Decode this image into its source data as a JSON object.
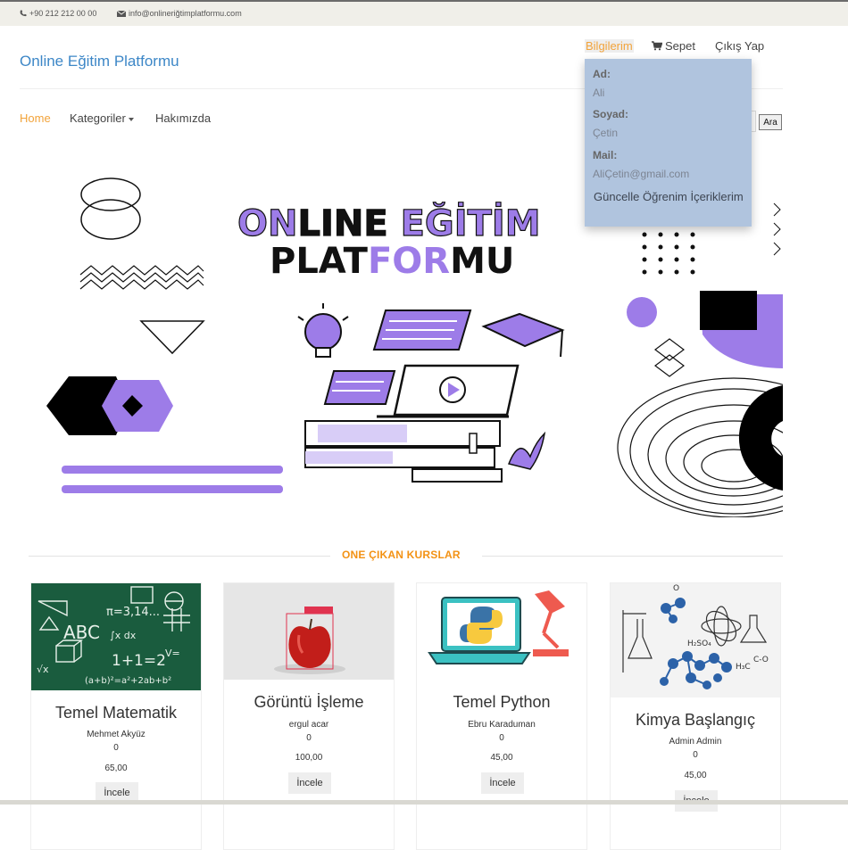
{
  "topbar": {
    "phone": "+90 212 212 00 00",
    "email": "info@onlineriğtimplatformu.com"
  },
  "brand": "Online Eğitim Platformu",
  "top_nav": {
    "bilgilerim": "Bilgilerim",
    "sepet": "Sepet",
    "cikis": "Çıkış Yap"
  },
  "main_nav": {
    "home": "Home",
    "kategoriler": "Kategoriler",
    "hakkimizda": "Hakımızda"
  },
  "search": {
    "button": "Ara"
  },
  "dropdown": {
    "ad_label": "Ad:",
    "ad_value": "Ali",
    "soyad_label": "Soyad:",
    "soyad_value": "Çetin",
    "mail_label": "Mail:",
    "mail_value": "AliÇetin@gmail.com",
    "guncelle": "Güncelle",
    "ogrenim": "Öğrenim İçeriklerim"
  },
  "banner": {
    "line1_part_a": "ON",
    "line1_part_b": "LINE ",
    "line1_part_c": "EĞİTİM",
    "line2_part_a": "PLAT",
    "line2_part_b": "FOR",
    "line2_part_c": "MU"
  },
  "section_title": "ONE ÇIKAN KURSLAR",
  "courses": [
    {
      "title": "Temel Matematik",
      "teacher": "Mehmet Akyüz",
      "count": "0",
      "price": "65,00",
      "button": "İncele"
    },
    {
      "title": "Görüntü İşleme",
      "teacher": "ergul acar",
      "count": "0",
      "price": "100,00",
      "button": "İncele"
    },
    {
      "title": "Temel Python",
      "teacher": "Ebru Karaduman",
      "count": "0",
      "price": "45,00",
      "button": "İncele"
    },
    {
      "title": "Kimya Başlangıç",
      "teacher": "Admin Admin",
      "count": "0",
      "price": "45,00",
      "button": "İncele"
    }
  ],
  "colors": {
    "brand": "#3d87c7",
    "accent_orange": "#f2a33a",
    "dropdown_bg": "#b0c4de",
    "purple": "#9d7ce8"
  },
  "icons": [
    "phone-icon",
    "envelope-icon",
    "cart-icon",
    "caret-down-icon"
  ]
}
